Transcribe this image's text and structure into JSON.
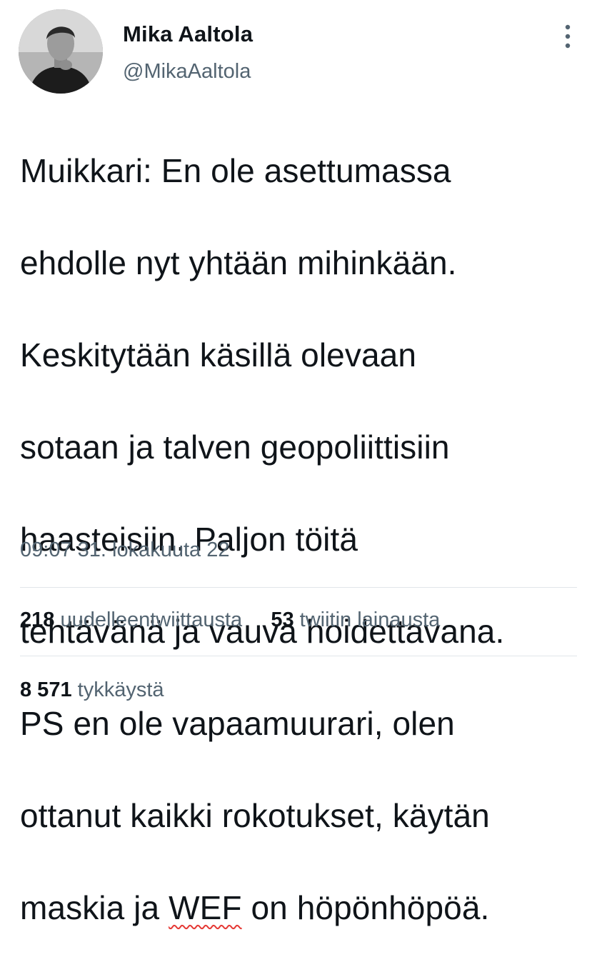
{
  "author": {
    "display_name": "Mika Aaltola",
    "handle": "@MikaAaltola",
    "avatar_icon": "profile-photo"
  },
  "tweet": {
    "lines": [
      "Muikkari: En ole asettumassa",
      "ehdolle nyt yhtään mihinkään.",
      "Keskitytään käsillä olevaan",
      "sotaan ja talven geopoliittisiin",
      "haasteisiin. Paljon töitä",
      "tehtävänä ja vauva hoidettavana.",
      "PS en ole vapaamuurari, olen",
      "ottanut kaikki rokotukset, käytän"
    ],
    "last_line": {
      "before": "maskia ja ",
      "misspelled_word": "WEF",
      "after": " on höpönhöpöä."
    },
    "timestamp": "09:07 31. lokakuuta 22"
  },
  "stats": {
    "retweets": {
      "count": "218",
      "label": "uudelleentwiittausta"
    },
    "quotes": {
      "count": "53",
      "label": "twiitin lainausta"
    },
    "likes": {
      "count": "8 571",
      "label": "tykkäystä"
    }
  },
  "colors": {
    "text": "#0f1419",
    "secondary": "#536471",
    "divider": "#e1e6ea",
    "spellcheck_underline": "#e53935"
  },
  "icons": {
    "more": "vertical-ellipsis-icon"
  }
}
